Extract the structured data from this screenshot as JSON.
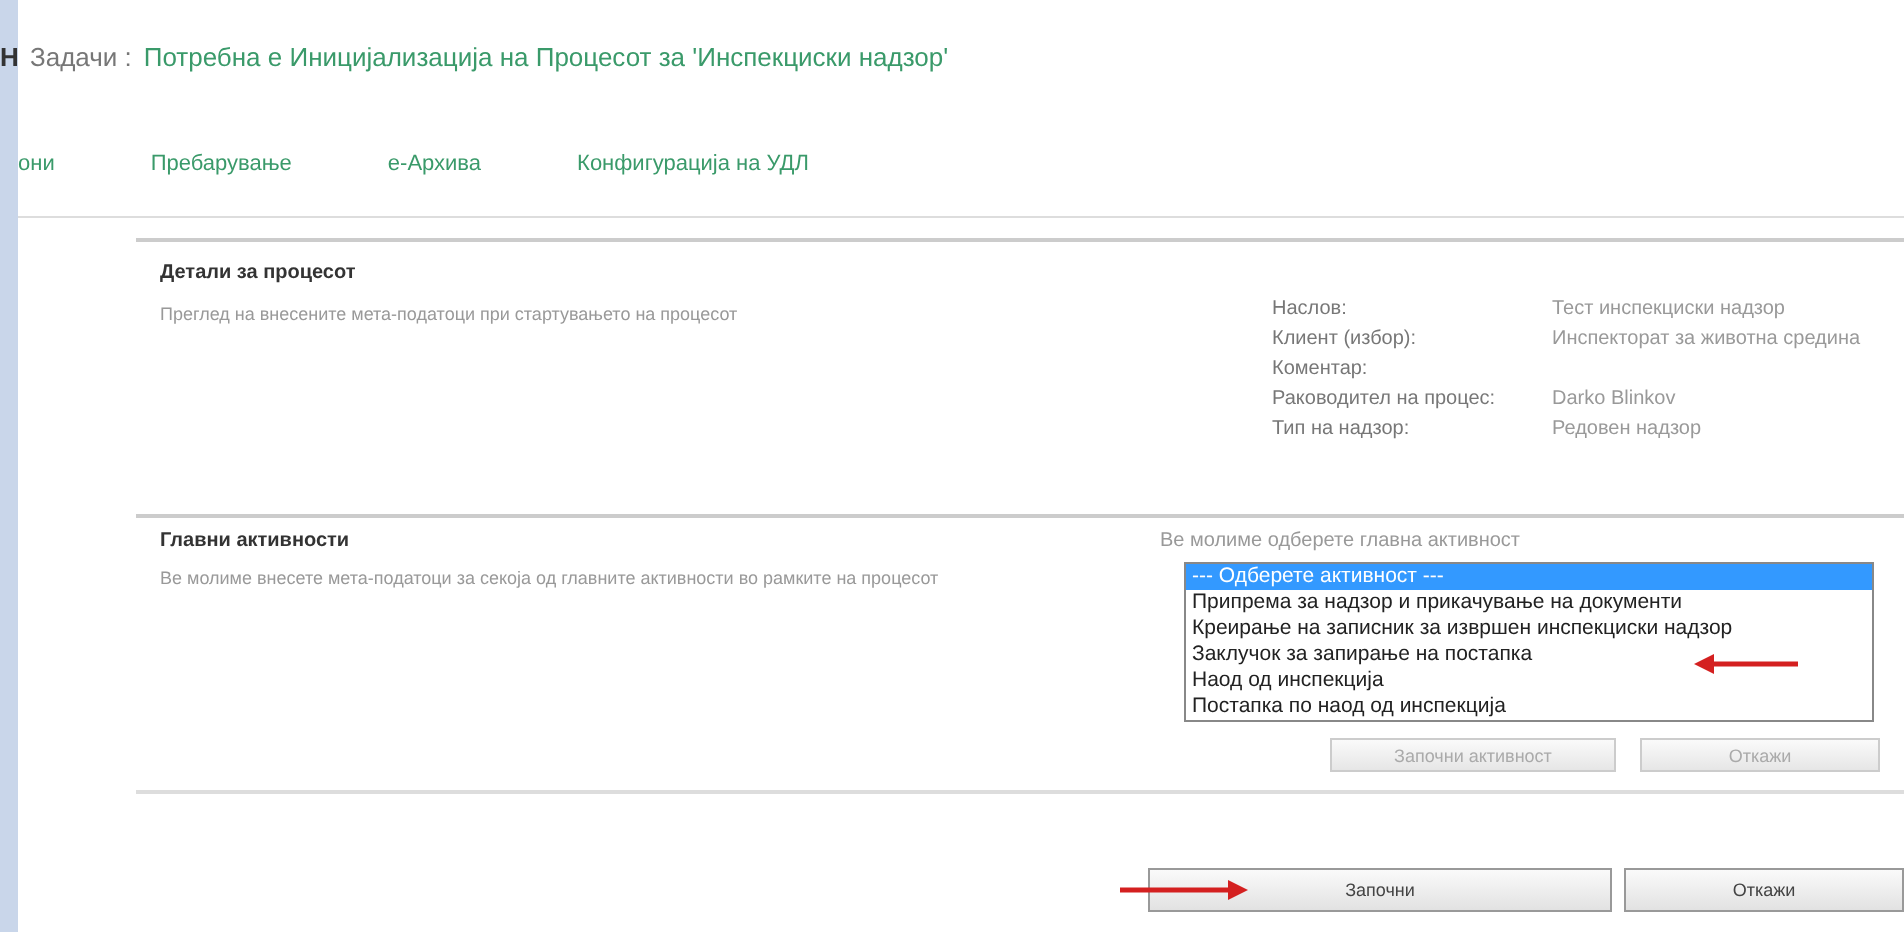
{
  "header": {
    "cut_label": "Н",
    "section": "Задачи :",
    "title": "Потребна е Иницијализација на Процесот за 'Инспекциски надзор'"
  },
  "nav": [
    {
      "label": "они"
    },
    {
      "label": "Пребарување"
    },
    {
      "label": "е-Архива"
    },
    {
      "label": "Конфигурација на УДЛ"
    }
  ],
  "process_details": {
    "heading": "Детали за процесот",
    "description": "Преглед на внесените мета-податоци при стартувањето на процесот",
    "fields": [
      {
        "label": "Наслов:",
        "value": "Тест инспекциски надзор"
      },
      {
        "label": "Клиент (избор):",
        "value": "Инспекторат за животна средина"
      },
      {
        "label": "Коментар:"
      },
      {
        "label": "Раководител на процес:",
        "value": "Darko Blinkov"
      },
      {
        "label": "Тип на надзор:",
        "value": "Редовен надзор"
      }
    ]
  },
  "main_activities": {
    "heading": "Главни активности",
    "description": "Ве молиме внесете мета-податоци за секоја од главните активности во рамките на процесот",
    "prompt": "Ве молиме одберете главна активност",
    "options": [
      {
        "label": "--- Одберете активност ---",
        "selected": true
      },
      {
        "label": "Припрема за надзор и прикачување на документи",
        "selected": false
      },
      {
        "label": "Креирање на записник за извршен инспекциски надзор",
        "selected": false
      },
      {
        "label": "Заклучок за запирање на постапка",
        "selected": false
      },
      {
        "label": "Наод од инспекција",
        "selected": false
      },
      {
        "label": "Постапка по наод од инспекција",
        "selected": false
      }
    ],
    "buttons": [
      "Започни активност",
      "Откажи"
    ]
  },
  "buttons": [
    "Започни",
    "Откажи"
  ]
}
